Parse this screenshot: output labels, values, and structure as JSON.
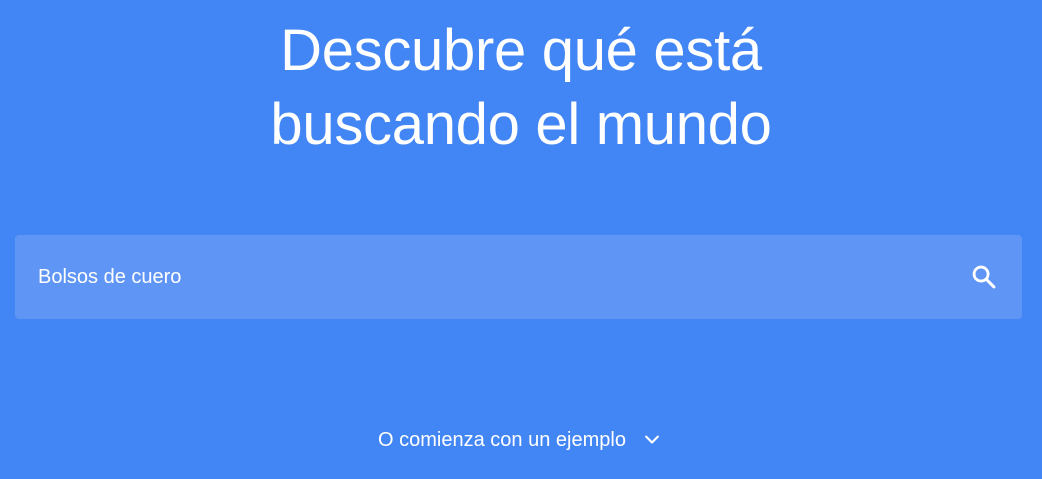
{
  "hero": {
    "headline_line1": "Descubre qué está",
    "headline_line2": "buscando el mundo"
  },
  "search": {
    "placeholder": "Bolsos de cuero",
    "value": "",
    "icon": "search-icon"
  },
  "examples": {
    "label": "O comienza con un ejemplo",
    "icon": "chevron-down-icon"
  },
  "colors": {
    "background": "#4285f4",
    "search_box": "#5f96f5",
    "text": "#ffffff"
  }
}
